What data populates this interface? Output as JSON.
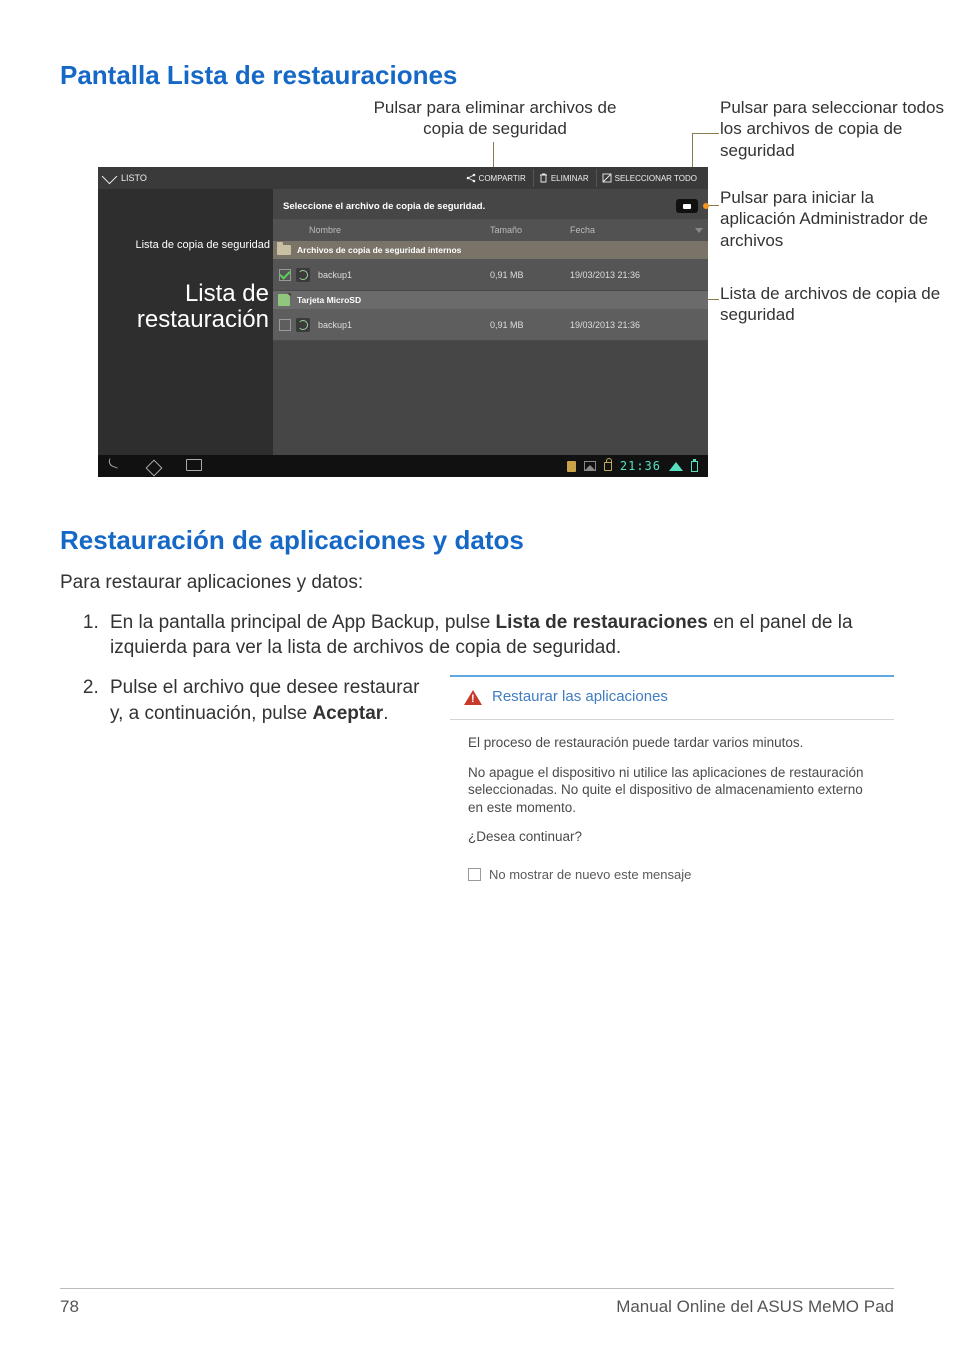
{
  "page": {
    "number": "78",
    "footer": "Manual Online del ASUS MeMO Pad"
  },
  "section1": {
    "title": "Pantalla Lista de restauraciones",
    "callouts": {
      "top": "Pulsar para eliminar archivos de copia de seguridad",
      "right1": "Pulsar para seleccionar todos los archivos de copia de seguridad",
      "right2": "Pulsar para iniciar la aplicación Administrador de archivos",
      "right3": "Lista de archivos de copia de seguridad",
      "left1": "Lista de copia de seguridad",
      "left2": "Lista de restauración"
    }
  },
  "device": {
    "topbar": {
      "listo": "LISTO",
      "compartir": "COMPARTIR",
      "eliminar": "ELIMINAR",
      "seleccionar_todo": "SELECCIONAR TODO"
    },
    "panel_title": "Seleccione el archivo de copia de seguridad.",
    "columns": {
      "nombre": "Nombre",
      "tamano": "Tamaño",
      "fecha": "Fecha"
    },
    "group_internal": "Archivos de copia de seguridad internos",
    "group_sd": "Tarjeta MicroSD",
    "rows": [
      {
        "name": "backup1",
        "size": "0,91 MB",
        "date": "19/03/2013 21:36",
        "checked": true
      },
      {
        "name": "backup1",
        "size": "0,91 MB",
        "date": "19/03/2013 21:36",
        "checked": false
      }
    ],
    "status_time": "21:36"
  },
  "section2": {
    "title": "Restauración de aplicaciones y datos",
    "intro": "Para restaurar aplicaciones y datos:",
    "step1_a": "En la pantalla principal de App Backup, pulse ",
    "step1_b": "Lista de restauraciones",
    "step1_c": " en el panel de la izquierda para ver la lista de archivos de copia de seguridad.",
    "step2_a": "Pulse el archivo que desee restaurar y, a continuación, pulse ",
    "step2_b": "Aceptar",
    "step2_c": "."
  },
  "dialog": {
    "title": "Restaurar las aplicaciones",
    "p1": "El proceso de restauración puede tardar varios minutos.",
    "p2": "No apague el dispositivo ni utilice las aplicaciones de restauración seleccionadas. No quite el dispositivo de almacenamiento externo en este momento.",
    "p3": "¿Desea continuar?",
    "checkbox_label": "No mostrar de nuevo este mensaje"
  }
}
